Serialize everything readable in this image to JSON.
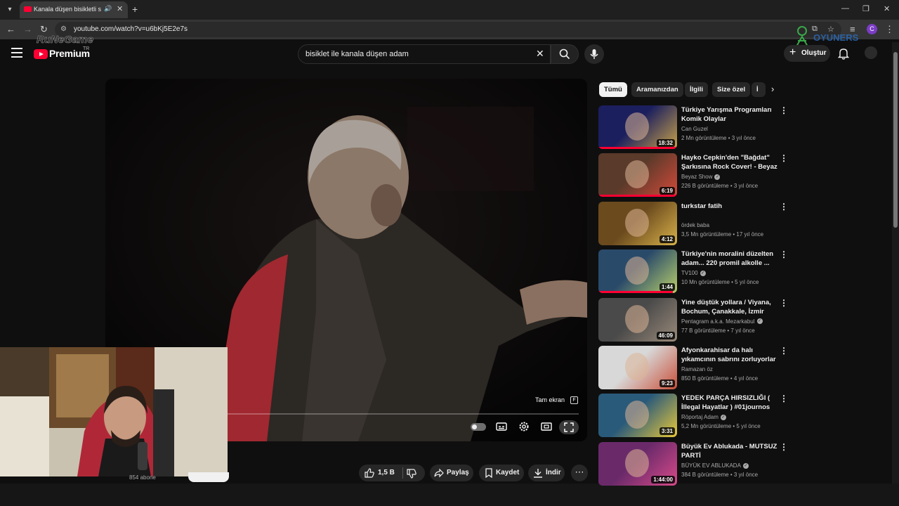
{
  "browser": {
    "tab_title": "Kanala düşen bisikletli sarhoş",
    "url": "youtube.com/watch?v=u6bKj5E2e7s",
    "profile_initial": "C"
  },
  "header": {
    "logo_text": "Premium",
    "region": "TR",
    "watermark_left": "RuNeGame",
    "watermark_right": "OYUNERS",
    "search_query": "bisiklet ile kanala düşen adam",
    "create_label": "Oluştur"
  },
  "player": {
    "fullscreen_tip": "Tam ekran",
    "fullscreen_key": "F"
  },
  "below": {
    "subscribers": "854 abone",
    "like_count": "1,5 B",
    "share_label": "Paylaş",
    "save_label": "Kaydet",
    "download_label": "İndir"
  },
  "chips": [
    "Tümü",
    "Aramanızdan",
    "İlgili",
    "Size özel",
    "İ"
  ],
  "recommendations": [
    {
      "title": "Türkiye Yarışma Programları Komik Olaylar",
      "channel": "Can Guzel",
      "verified": false,
      "meta": "2 Mn görüntüleme • 3 yıl önce",
      "duration": "18:32",
      "colors": [
        "#1b1f5e",
        "#c9a24a"
      ]
    },
    {
      "title": "Hayko Cepkin'den \"Bağdat\" Şarkısına Rock Cover! - Beyaz ...",
      "channel": "Beyaz Show",
      "verified": true,
      "meta": "226 B görüntüleme • 3 yıl önce",
      "duration": "6:19",
      "colors": [
        "#5a3a2a",
        "#d44a3a"
      ]
    },
    {
      "title": "turkstar fatih",
      "channel": "ördek baba",
      "verified": false,
      "meta": "3,5 Mn görüntüleme • 17 yıl önce",
      "duration": "4:12",
      "colors": [
        "#6b4a1e",
        "#d8b24a"
      ]
    },
    {
      "title": "Türkiye'nin moralini düzelten adam... 220 promil alkolle ...",
      "channel": "TV100",
      "verified": true,
      "meta": "10 Mn görüntüleme • 5 yıl önce",
      "duration": "1:44",
      "colors": [
        "#2a4a6a",
        "#b8d06a"
      ]
    },
    {
      "title": "Yine düştük yollara / Viyana, Bochum, Çanakkale, İzmir",
      "channel": "Pentagram a.k.a. Mezarkabul",
      "verified": true,
      "meta": "77 B görüntüleme • 7 yıl önce",
      "duration": "46:09",
      "colors": [
        "#4a4a4a",
        "#9a8a7a"
      ]
    },
    {
      "title": "Afyonkarahisar da halı yıkamcının sabrını zorluyorlar ...",
      "channel": "Ramazan öz",
      "verified": false,
      "meta": "850 B görüntüleme • 4 yıl önce",
      "duration": "9:23",
      "colors": [
        "#d8d8d8",
        "#c8503a"
      ]
    },
    {
      "title": "YEDEK PARÇA HIRSIZLIĞI ( İllegal Hayatlar ) #01journos -...",
      "channel": "Röportaj Adam",
      "verified": true,
      "meta": "5,2 Mn görüntüleme • 5 yıl önce",
      "duration": "3:31",
      "colors": [
        "#2a5a7a",
        "#e8c83a"
      ]
    },
    {
      "title": "Büyük Ev Ablukada - MUTSUZ PARTİ",
      "channel": "BÜYÜK EV ABLUKADA",
      "verified": true,
      "meta": "384 B görüntüleme • 3 yıl önce",
      "duration": "1:44:00",
      "colors": [
        "#6a2a6a",
        "#d84a8a"
      ]
    }
  ]
}
